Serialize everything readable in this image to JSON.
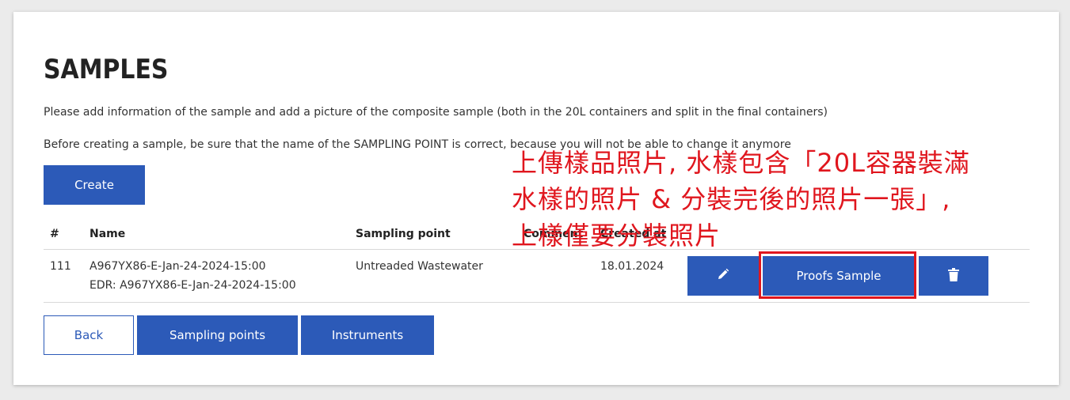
{
  "page": {
    "title": "SAMPLES",
    "description1": "Please add information of the sample and add a picture of the composite sample (both in the 20L containers and split in the final containers)",
    "description2": "Before creating a sample, be sure that the name of the SAMPLING POINT is correct, because you will not be able to change it anymore"
  },
  "actions": {
    "create_label": "Create"
  },
  "table": {
    "headers": {
      "num": "#",
      "name": "Name",
      "sampling_point": "Sampling point",
      "comment": "Comment",
      "created_at": "Created at"
    },
    "rows": [
      {
        "num": "111",
        "name": "A967YX86-E-Jan-24-2024-15:00",
        "edr": "EDR: A967YX86-E-Jan-24-2024-15:00",
        "sampling_point": "Untreaded Wastewater",
        "created_at": "18.01.2024",
        "proofs_label": "Proofs Sample"
      }
    ]
  },
  "footer": {
    "back_label": "Back",
    "sampling_points_label": "Sampling points",
    "instruments_label": "Instruments"
  },
  "annotation": {
    "line1": "上傳樣品照片, 水樣包含「20L容器裝滿",
    "line2": "水樣的照片 & 分裝完後的照片一張」,",
    "line3": "上樣僅要分裝照片"
  },
  "colors": {
    "primary": "#2c5ab8",
    "annotation": "#e0161e"
  },
  "icons": {
    "edit": "pencil-icon",
    "delete": "trash-icon"
  }
}
